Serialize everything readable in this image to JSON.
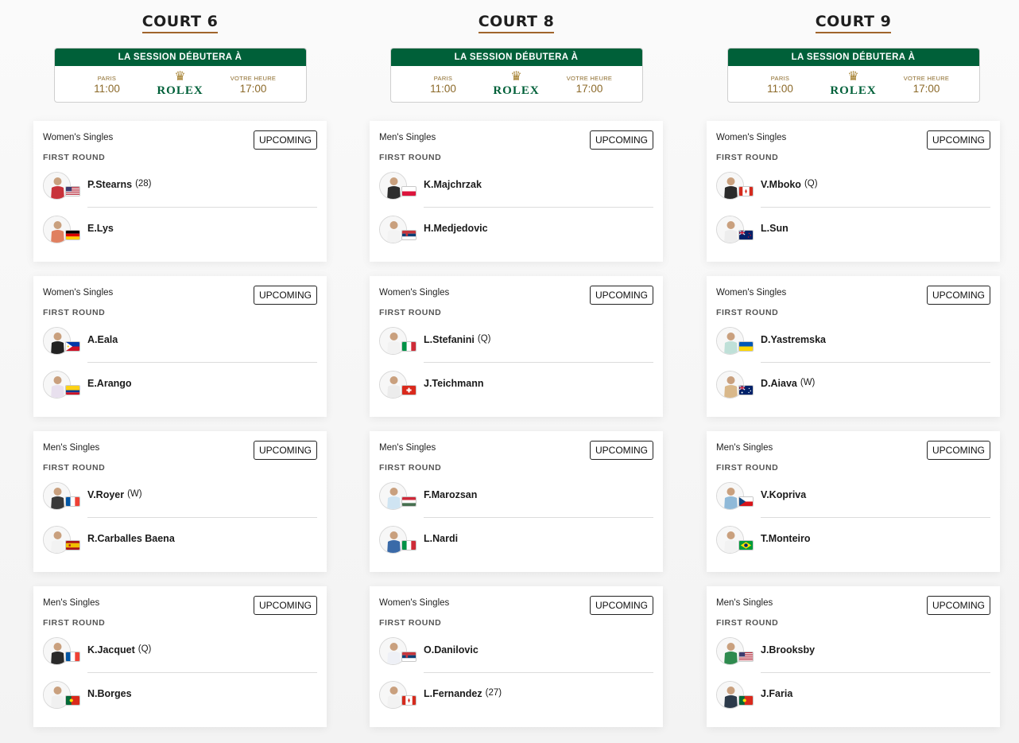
{
  "session": {
    "header": "LA SESSION DÉBUTERA À",
    "paris_label": "PARIS",
    "local_label": "VOTRE HEURE",
    "brand": "ROLEX",
    "crown_icon": "crown-icon"
  },
  "colors": {
    "rolex_green": "#006039",
    "gold": "#a37e2c",
    "underline": "#a0642c"
  },
  "courts": [
    {
      "title": "COURT 6",
      "paris_time": "11:00",
      "local_time": "17:00",
      "matches": [
        {
          "event": "Women's Singles",
          "round": "FIRST ROUND",
          "status": "UPCOMING",
          "players": [
            {
              "name": "P.Stearns",
              "seed": "(28)",
              "country": "USA",
              "shirt": "#c8323a"
            },
            {
              "name": "E.Lys",
              "seed": "",
              "country": "GER",
              "shirt": "#e08060"
            }
          ]
        },
        {
          "event": "Women's Singles",
          "round": "FIRST ROUND",
          "status": "UPCOMING",
          "players": [
            {
              "name": "A.Eala",
              "seed": "",
              "country": "PHI",
              "shirt": "#222222"
            },
            {
              "name": "E.Arango",
              "seed": "",
              "country": "COL",
              "shirt": "#e8e0ee"
            }
          ]
        },
        {
          "event": "Men's Singles",
          "round": "FIRST ROUND",
          "status": "UPCOMING",
          "players": [
            {
              "name": "V.Royer",
              "seed": "(W)",
              "country": "FRA",
              "shirt": "#3a3a3a"
            },
            {
              "name": "R.Carballes Baena",
              "seed": "",
              "country": "ESP",
              "shirt": "#f2f2f2"
            }
          ]
        },
        {
          "event": "Men's Singles",
          "round": "FIRST ROUND",
          "status": "UPCOMING",
          "players": [
            {
              "name": "K.Jacquet",
              "seed": "(Q)",
              "country": "FRA",
              "shirt": "#2a2a2a"
            },
            {
              "name": "N.Borges",
              "seed": "",
              "country": "POR",
              "shirt": "#f0f0f0"
            }
          ]
        }
      ]
    },
    {
      "title": "COURT 8",
      "paris_time": "11:00",
      "local_time": "17:00",
      "matches": [
        {
          "event": "Men's Singles",
          "round": "FIRST ROUND",
          "status": "UPCOMING",
          "players": [
            {
              "name": "K.Majchrzak",
              "seed": "",
              "country": "POL",
              "shirt": "#2d2d2d"
            },
            {
              "name": "H.Medjedovic",
              "seed": "",
              "country": "SRB",
              "shirt": "#f3f3f3"
            }
          ]
        },
        {
          "event": "Women's Singles",
          "round": "FIRST ROUND",
          "status": "UPCOMING",
          "players": [
            {
              "name": "L.Stefanini",
              "seed": "(Q)",
              "country": "ITA",
              "shirt": "#f2f2f2"
            },
            {
              "name": "J.Teichmann",
              "seed": "",
              "country": "SUI",
              "shirt": "#ececec"
            }
          ]
        },
        {
          "event": "Men's Singles",
          "round": "FIRST ROUND",
          "status": "UPCOMING",
          "players": [
            {
              "name": "F.Marozsan",
              "seed": "",
              "country": "HUN",
              "shirt": "#cfe4f2"
            },
            {
              "name": "L.Nardi",
              "seed": "",
              "country": "ITA",
              "shirt": "#3a6aa8"
            }
          ]
        },
        {
          "event": "Women's Singles",
          "round": "FIRST ROUND",
          "status": "UPCOMING",
          "players": [
            {
              "name": "O.Danilovic",
              "seed": "",
              "country": "SRB",
              "shirt": "#eef0f6"
            },
            {
              "name": "L.Fernandez",
              "seed": "(27)",
              "country": "CAN",
              "shirt": "#f2f2f2"
            }
          ]
        }
      ]
    },
    {
      "title": "COURT 9",
      "paris_time": "11:00",
      "local_time": "17:00",
      "matches": [
        {
          "event": "Women's Singles",
          "round": "FIRST ROUND",
          "status": "UPCOMING",
          "players": [
            {
              "name": "V.Mboko",
              "seed": "(Q)",
              "country": "CAN",
              "shirt": "#2a2a2a"
            },
            {
              "name": "L.Sun",
              "seed": "",
              "country": "NZL",
              "shirt": "#ededed"
            }
          ]
        },
        {
          "event": "Women's Singles",
          "round": "FIRST ROUND",
          "status": "UPCOMING",
          "players": [
            {
              "name": "D.Yastremska",
              "seed": "",
              "country": "UKR",
              "shirt": "#bfe0d8"
            },
            {
              "name": "D.Aiava",
              "seed": "(W)",
              "country": "AUS",
              "shirt": "#d9b88a"
            }
          ]
        },
        {
          "event": "Men's Singles",
          "round": "FIRST ROUND",
          "status": "UPCOMING",
          "players": [
            {
              "name": "V.Kopriva",
              "seed": "",
              "country": "CZE",
              "shirt": "#8fb9d8"
            },
            {
              "name": "T.Monteiro",
              "seed": "",
              "country": "BRA",
              "shirt": "#f2f2f2"
            }
          ]
        },
        {
          "event": "Men's Singles",
          "round": "FIRST ROUND",
          "status": "UPCOMING",
          "players": [
            {
              "name": "J.Brooksby",
              "seed": "",
              "country": "USA",
              "shirt": "#2e8a4e"
            },
            {
              "name": "J.Faria",
              "seed": "",
              "country": "POR",
              "shirt": "#2c3a4a"
            }
          ]
        }
      ]
    }
  ]
}
